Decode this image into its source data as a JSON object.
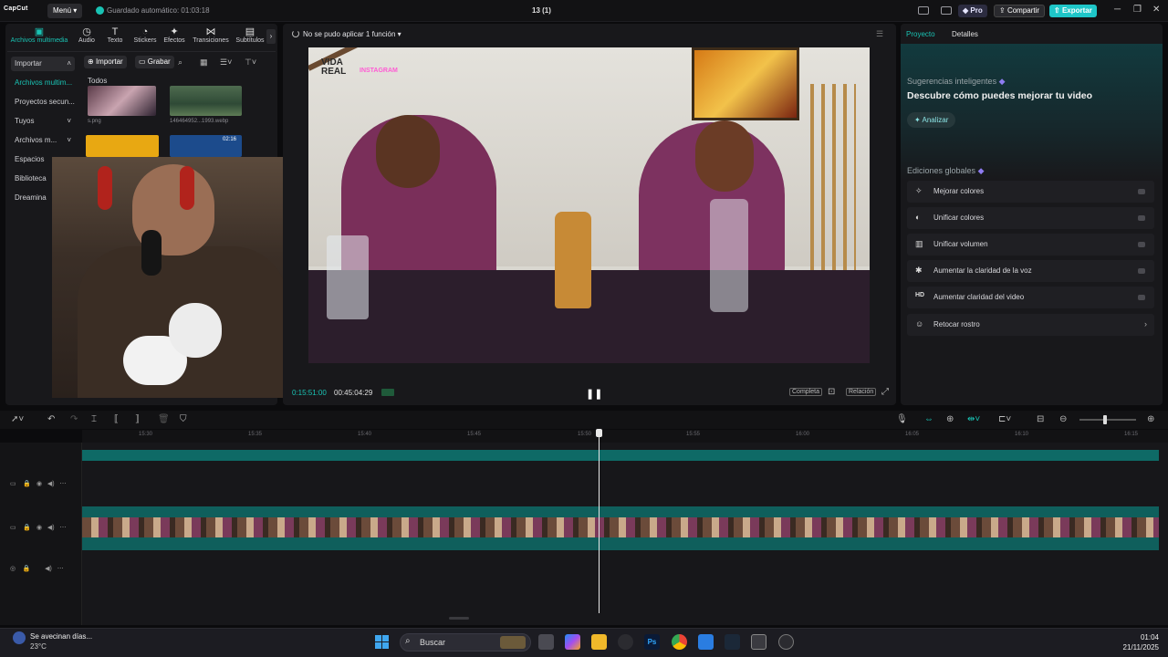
{
  "app": {
    "logo": "CapCut",
    "menu": "Menú",
    "autosave": "Guardado automático: 01:03:18",
    "title": "13 (1)",
    "pro": "Pro",
    "share": "Compartir",
    "export": "Exportar"
  },
  "tools": [
    {
      "label": "Archivos multimedia",
      "icon": "▣"
    },
    {
      "label": "Audio",
      "icon": "◷"
    },
    {
      "label": "Texto",
      "icon": "T"
    },
    {
      "label": "Stickers",
      "icon": "◔"
    },
    {
      "label": "Efectos",
      "icon": "✦"
    },
    {
      "label": "Transiciones",
      "icon": "⋈"
    },
    {
      "label": "Subtítulos",
      "icon": "▤"
    }
  ],
  "nav": {
    "import": "Importar",
    "media": "Archivos multim...",
    "secondary": "Proyectos secun...",
    "yours": "Tuyos",
    "files": "Archivos m...",
    "spaces": "Espacios",
    "library": "Biblioteca",
    "dreamina": "Dreamina"
  },
  "media": {
    "import_btn": "Importar",
    "record_btn": "Grabar",
    "all": "Todos",
    "thumb1_name": "s.png",
    "thumb2_name": "146464952...1993.webp",
    "thumb4_duration": "02:16"
  },
  "player": {
    "status": "No se pudo aplicar 1 función",
    "video_logo": "VIDA REAL",
    "video_ig": "INSTAGRAM",
    "time_current": "0:15:51:00",
    "time_total": "00:45:04:29",
    "full": "Completa",
    "ratio": "Relación"
  },
  "right": {
    "tab_project": "Proyecto",
    "tab_details": "Detalles",
    "suggestions_label": "Sugerencias inteligentes",
    "suggestions_title": "Descubre cómo puedes mejorar tu video",
    "analyze": "Analizar",
    "global_label": "Ediciones globales",
    "global_items": [
      {
        "icon": "✧",
        "label": "Mejorar colores"
      },
      {
        "icon": "◐",
        "label": "Unificar colores"
      },
      {
        "icon": "▥",
        "label": "Unificar volumen"
      },
      {
        "icon": "✱",
        "label": "Aumentar la claridad de la voz"
      },
      {
        "icon": "HD",
        "label": "Aumentar claridad del video"
      },
      {
        "icon": "☺",
        "label": "Retocar rostro"
      }
    ]
  },
  "timeline": {
    "ticks": [
      "15:30",
      "15:35",
      "15:40",
      "15:45",
      "15:50",
      "15:55",
      "16:00",
      "16:05",
      "16:10",
      "16:15"
    ]
  },
  "taskbar": {
    "weather_text": "Se avecinan días...",
    "weather_temp": "23°C",
    "search": "Buscar",
    "time": "01:04",
    "date": "21/11/2025"
  },
  "colors": {
    "accent": "#19c3b4",
    "export": "#1ec6c8"
  }
}
